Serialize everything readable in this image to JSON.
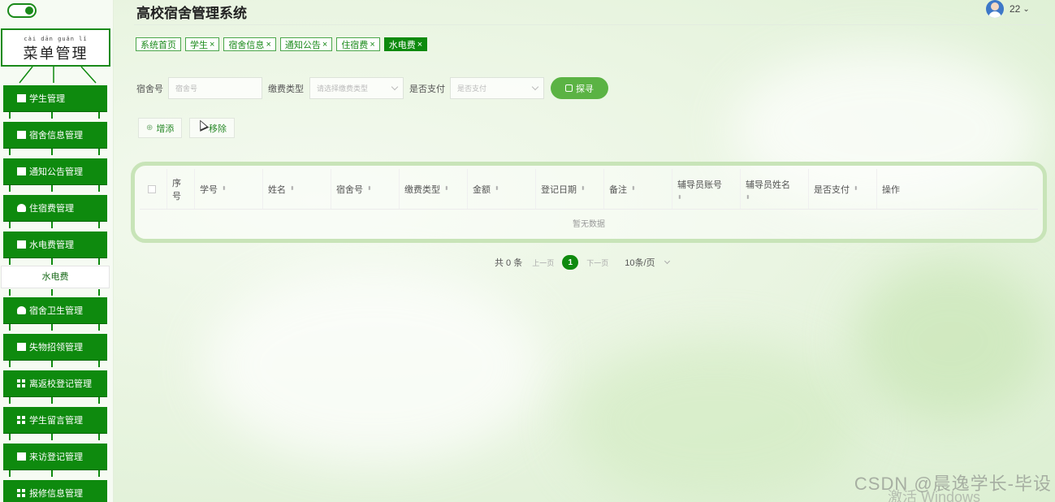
{
  "header": {
    "title": "高校宿舍管理系统",
    "user_name": "22",
    "user_caret": "⌄"
  },
  "sidebar": {
    "menu_title_pinyin": "cài dān guǎn lǐ",
    "menu_title": "菜单管理",
    "items": [
      {
        "label": "学生管理",
        "icon": "briefcase-icon"
      },
      {
        "label": "宿舍信息管理",
        "icon": "monitor-icon"
      },
      {
        "label": "通知公告管理",
        "icon": "chart-icon"
      },
      {
        "label": "住宿费管理",
        "icon": "person-icon"
      },
      {
        "label": "水电费管理",
        "icon": "clipboard-icon"
      },
      {
        "label": "宿舍卫生管理",
        "icon": "person-icon"
      },
      {
        "label": "失物招领管理",
        "icon": "book-icon"
      },
      {
        "label": "离返校登记管理",
        "icon": "grid-icon"
      },
      {
        "label": "学生留言管理",
        "icon": "grid-icon"
      },
      {
        "label": "来访登记管理",
        "icon": "ticket-icon"
      },
      {
        "label": "报修信息管理",
        "icon": "grid-icon"
      }
    ],
    "sub_item": "水电费"
  },
  "tabs": [
    {
      "label": "系统首页",
      "closable": false
    },
    {
      "label": "学生",
      "closable": true
    },
    {
      "label": "宿舍信息",
      "closable": true
    },
    {
      "label": "通知公告",
      "closable": true
    },
    {
      "label": "住宿费",
      "closable": true
    },
    {
      "label": "水电费",
      "closable": true,
      "active": true
    }
  ],
  "tab_close": "×",
  "search": {
    "room_label": "宿舍号",
    "room_placeholder": "宿舍号",
    "type_label": "缴费类型",
    "type_placeholder": "请选择缴费类型",
    "paid_label": "是否支付",
    "paid_placeholder": "是否支付",
    "button": "探寻"
  },
  "actions": {
    "add": "增添",
    "add_icon": "⊕",
    "remove": "移除"
  },
  "table": {
    "columns": [
      "序号",
      "学号",
      "姓名",
      "宿舍号",
      "缴费类型",
      "金额",
      "登记日期",
      "备注",
      "辅导员账号",
      "辅导员姓名",
      "是否支付",
      "操作"
    ],
    "seq_top": "序",
    "seq_bottom": "号",
    "empty_text": "暂无数据",
    "sort_glyph": "⬍"
  },
  "pagination": {
    "total": "共 0 条",
    "prev": "上一页",
    "page": "1",
    "next": "下一页",
    "page_size": "10条/页"
  },
  "watermark": {
    "csdn": "CSDN @晨逸学长-毕设",
    "windows": "激活 Windows"
  },
  "colors": {
    "primary": "#0e8a0e",
    "accent": "#5bb344",
    "table_border": "#c8e4b8"
  }
}
